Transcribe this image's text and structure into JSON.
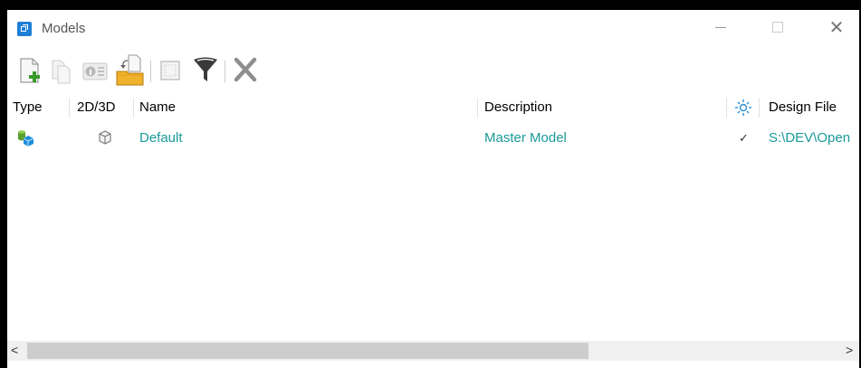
{
  "window": {
    "title": "Models",
    "minimize_glyph": "—",
    "maximize_glyph": "☐",
    "close_glyph": "✕"
  },
  "toolbar": {
    "icons": [
      "new-model-icon",
      "copy-model-icon",
      "model-properties-icon",
      "import-model-icon",
      "select-all-icon",
      "filter-icon",
      "delete-icon"
    ]
  },
  "table": {
    "columns": {
      "type": "Type",
      "dim": "2D/3D",
      "name": "Name",
      "description": "Description",
      "active_icon": "sun-icon",
      "design_file": "Design File"
    },
    "rows": [
      {
        "type_icon": "design-model-icon",
        "dim_icon": "3d-cube-icon",
        "name": "Default",
        "description": "Master Model",
        "active_mark": "✓",
        "design_file": "S:\\DEV\\Open"
      }
    ],
    "text_color": "#1a9a9a"
  },
  "scrollbar": {
    "left_arrow": "<",
    "right_arrow": ">"
  }
}
